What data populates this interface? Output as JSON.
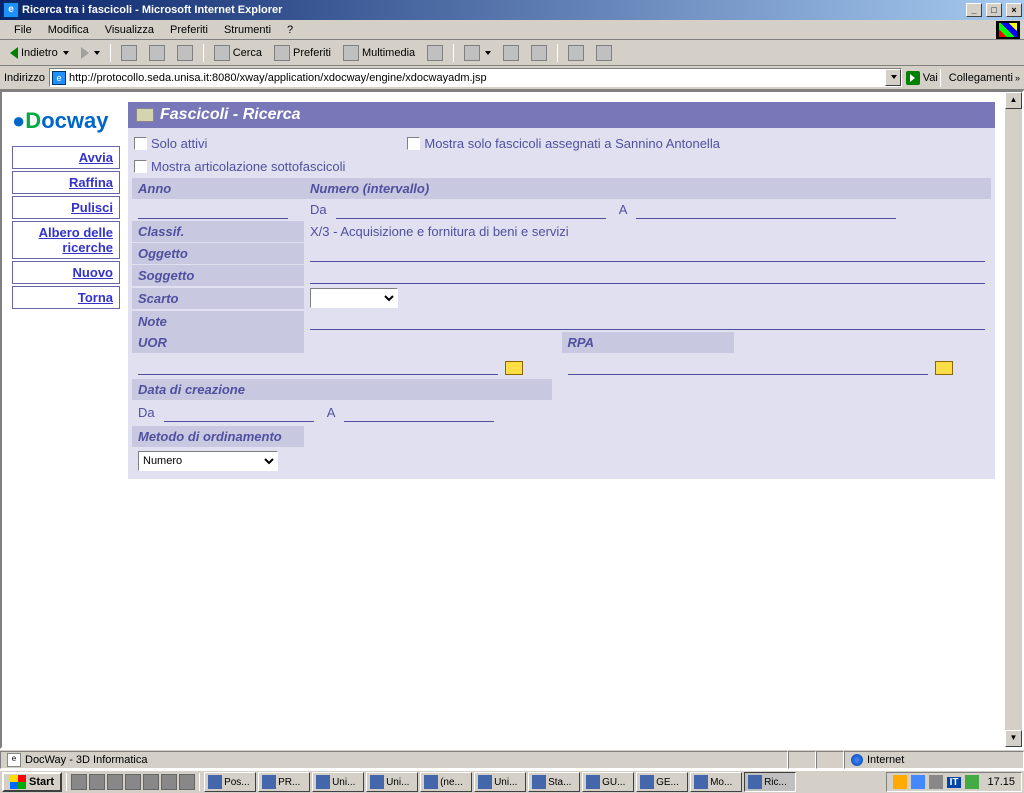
{
  "window": {
    "title": "Ricerca tra i fascicoli - Microsoft Internet Explorer"
  },
  "menu": {
    "file": "File",
    "modifica": "Modifica",
    "visualizza": "Visualizza",
    "preferiti": "Preferiti",
    "strumenti": "Strumenti",
    "help": "?"
  },
  "toolbar": {
    "back": "Indietro",
    "search": "Cerca",
    "favorites": "Preferiti",
    "media": "Multimedia"
  },
  "address": {
    "label": "Indirizzo",
    "url": "http://protocollo.seda.unisa.it:8080/xway/application/xdocway/engine/xdocwayadm.jsp",
    "go": "Vai",
    "links": "Collegamenti"
  },
  "logo": {
    "part1": "D",
    "part2": "ocway"
  },
  "sidebar": {
    "avvia": "Avvia",
    "raffina": "Raffina",
    "pulisci": "Pulisci",
    "albero": "Albero delle ricerche",
    "nuovo": "Nuovo",
    "torna": "Torna"
  },
  "panel": {
    "title": "Fascicoli - Ricerca",
    "solo_attivi": "Solo attivi",
    "mostra_assegnati": "Mostra solo fascicoli assegnati a Sannino Antonella",
    "mostra_artic": "Mostra articolazione sottofascicoli",
    "anno": "Anno",
    "numero": "Numero (intervallo)",
    "da": "Da",
    "a": "A",
    "classif": "Classif.",
    "classif_val": "X/3 - Acquisizione e fornitura di beni e servizi",
    "oggetto": "Oggetto",
    "soggetto": "Soggetto",
    "scarto": "Scarto",
    "note": "Note",
    "uor": "UOR",
    "rpa": "RPA",
    "data_creazione": "Data di creazione",
    "metodo": "Metodo di ordinamento",
    "metodo_val": "Numero"
  },
  "statusbar": {
    "text": "DocWay - 3D Informatica",
    "zone": "Internet"
  },
  "taskbar": {
    "start": "Start",
    "items": [
      {
        "label": "Pos..."
      },
      {
        "label": "PR..."
      },
      {
        "label": "Uni..."
      },
      {
        "label": "Uni..."
      },
      {
        "label": "(ne..."
      },
      {
        "label": "Uni..."
      },
      {
        "label": "Sta..."
      },
      {
        "label": "GU..."
      },
      {
        "label": "GE..."
      },
      {
        "label": "Mo..."
      },
      {
        "label": "Ric..."
      }
    ],
    "lang": "IT",
    "clock": "17.15"
  }
}
